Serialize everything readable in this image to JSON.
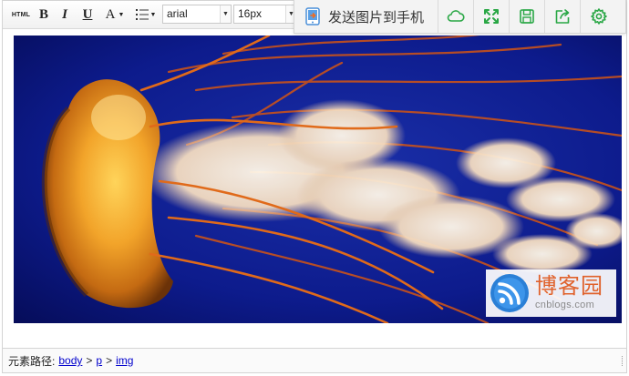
{
  "toolbar": {
    "html_label": "HTML",
    "bold_label": "B",
    "italic_label": "I",
    "underline_label": "U",
    "fontcolor_label": "A",
    "font_family": "arial",
    "font_size": "16px"
  },
  "sharebar": {
    "send_label": "发送图片到手机",
    "icons": [
      "cloud-icon",
      "fullscreen-icon",
      "save-icon",
      "share-icon",
      "settings-icon"
    ],
    "accent_color": "#29a745"
  },
  "watermark": {
    "name_cn": "博客园",
    "name_en": "cnblogs.com",
    "brand_color": "#e0622c",
    "logo_color": "#2a7fd6"
  },
  "statusbar": {
    "path_label": "元素路径:",
    "path": [
      "body",
      "p",
      "img"
    ],
    "separator": ">"
  }
}
